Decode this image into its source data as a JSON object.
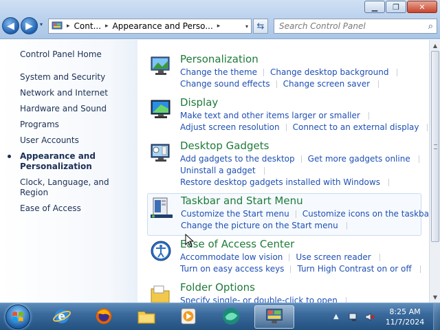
{
  "window": {
    "minimize_glyph": "▁",
    "maximize_glyph": "❐",
    "close_glyph": "✕"
  },
  "nav": {
    "back_glyph": "◀",
    "forward_glyph": "▶",
    "recent_glyph": "▾"
  },
  "address": {
    "crumbs": [
      "Cont...",
      "Appearance and Perso..."
    ],
    "separator_glyph": "▸",
    "dropdown_glyph": "▾",
    "refresh_glyph": "⇆"
  },
  "search": {
    "placeholder": "Search Control Panel",
    "icon": "search-icon",
    "icon_glyph": "⌕"
  },
  "sidebar": {
    "home": "Control Panel Home",
    "items": [
      {
        "label": "System and Security"
      },
      {
        "label": "Network and Internet"
      },
      {
        "label": "Hardware and Sound"
      },
      {
        "label": "Programs"
      },
      {
        "label": "User Accounts"
      },
      {
        "label": "Appearance and\nPersonalization",
        "active": true
      },
      {
        "label": "Clock, Language, and Region"
      },
      {
        "label": "Ease of Access"
      }
    ]
  },
  "categories": [
    {
      "title": "Personalization",
      "icon": "personalization-icon",
      "rows": [
        [
          "Change the theme",
          "Change desktop background"
        ],
        [
          "Change sound effects",
          "Change screen saver"
        ]
      ]
    },
    {
      "title": "Display",
      "icon": "display-icon",
      "rows": [
        [
          "Make text and other items larger or smaller"
        ],
        [
          "Adjust screen resolution",
          "Connect to an external display"
        ]
      ]
    },
    {
      "title": "Desktop Gadgets",
      "icon": "gadgets-icon",
      "rows": [
        [
          "Add gadgets to the desktop",
          "Get more gadgets online"
        ],
        [
          "Uninstall a gadget"
        ],
        [
          "Restore desktop gadgets installed with Windows"
        ]
      ]
    },
    {
      "title": "Taskbar and Start Menu",
      "icon": "taskbar-icon",
      "hovered": true,
      "rows": [
        [
          "Customize the Start menu",
          "Customize icons on the taskbar"
        ],
        [
          "Change the picture on the Start menu"
        ]
      ]
    },
    {
      "title": "Ease of Access Center",
      "icon": "ease-of-access-icon",
      "rows": [
        [
          "Accommodate low vision",
          "Use screen reader"
        ],
        [
          "Turn on easy access keys",
          "Turn High Contrast on or off"
        ]
      ]
    },
    {
      "title": "Folder Options",
      "icon": "folder-options-icon",
      "rows": [
        [
          "Specify single- or double-click to open"
        ]
      ]
    }
  ],
  "taskbar": {
    "apps": [
      {
        "name": "internet-explorer-icon"
      },
      {
        "name": "firefox-icon"
      },
      {
        "name": "file-explorer-icon"
      },
      {
        "name": "media-player-icon"
      },
      {
        "name": "app-icon"
      },
      {
        "name": "control-panel-icon",
        "active": true
      }
    ],
    "tray_arrow_glyph": "▲",
    "clock": {
      "time": "8:25 AM",
      "date": "11/7/2024"
    }
  },
  "colors": {
    "link": "#1e4fb3",
    "category_title": "#1e7a3a",
    "sidebar_text": "#1b2f55"
  }
}
